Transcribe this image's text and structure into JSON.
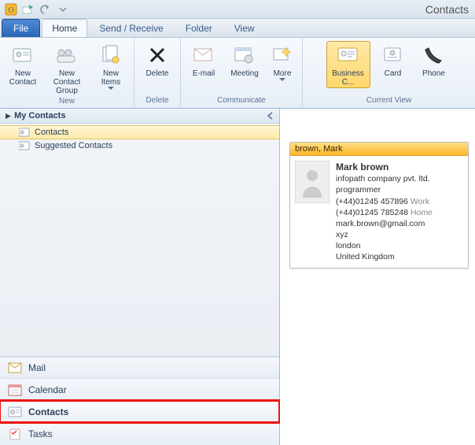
{
  "titlebar": {
    "title": "Contacts"
  },
  "tabs": {
    "file": "File",
    "home": "Home",
    "sendreceive": "Send / Receive",
    "folder": "Folder",
    "view": "View"
  },
  "ribbon": {
    "new": {
      "label": "New",
      "newcontact": "New\nContact",
      "newgroup": "New Contact\nGroup",
      "newitems": "New\nItems"
    },
    "delete": {
      "label": "Delete",
      "delete": "Delete"
    },
    "communicate": {
      "label": "Communicate",
      "email": "E-mail",
      "meeting": "Meeting",
      "more": "More"
    },
    "currentview": {
      "label": "Current View",
      "business": "Business C...",
      "card": "Card",
      "phone": "Phone"
    }
  },
  "nav": {
    "header": "My Contacts",
    "items": [
      {
        "label": "Contacts",
        "selected": true
      },
      {
        "label": "Suggested Contacts",
        "selected": false
      }
    ],
    "sections": {
      "mail": "Mail",
      "calendar": "Calendar",
      "contacts": "Contacts",
      "tasks": "Tasks"
    }
  },
  "card": {
    "header": "brown, Mark",
    "name": "Mark brown",
    "company": "infopath company pvt. ltd.",
    "title": "programmer",
    "phone_work": "(+44)01245 457896",
    "phone_work_label": "Work",
    "phone_home": "(+44)01245 785248",
    "phone_home_label": "Home",
    "email": "mark.brown@gmail.com",
    "addr1": "xyz",
    "addr2": "london",
    "addr3": "United Kingdom"
  }
}
